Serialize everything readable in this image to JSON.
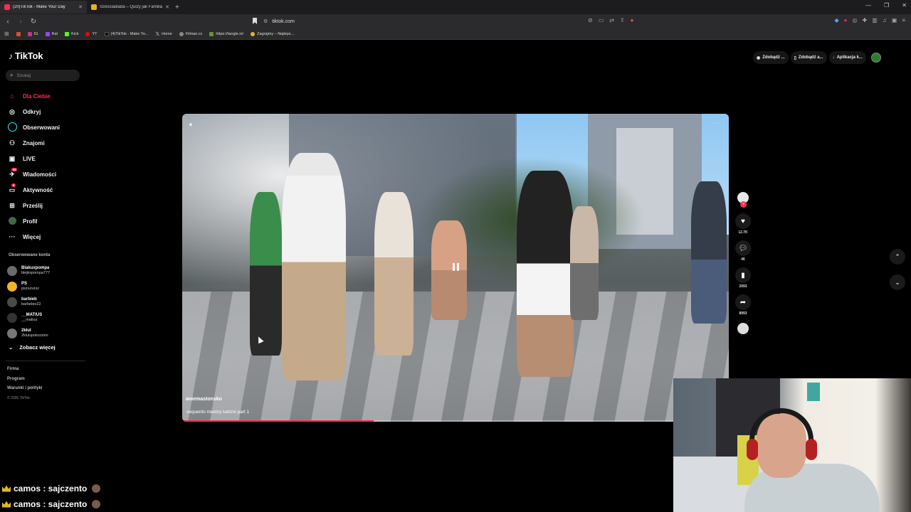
{
  "browser": {
    "tabs": [
      {
        "title": "(20)TikTok - Make Your Day",
        "active": true
      },
      {
        "title": "Sześciadiada – Quizy jak Familiada! G",
        "active": false
      }
    ],
    "url": "tiktok.com",
    "bookmarks": [
      "IG",
      "Rat",
      "Kick",
      "YT",
      "(4)TikTok - Make Yo...",
      "Home",
      "Filman.cc",
      "https://tangle.io/",
      "Zagrajmy – Najleps..."
    ]
  },
  "tiktok": {
    "logo": "TikTok",
    "search_placeholder": "Szukaj",
    "nav": [
      {
        "label": "Dla Ciebie",
        "icon": "home-icon",
        "active": true
      },
      {
        "label": "Odkryj",
        "icon": "compass-icon"
      },
      {
        "label": "Obserwowani",
        "icon": "following-icon"
      },
      {
        "label": "Znajomi",
        "icon": "friends-icon"
      },
      {
        "label": "LIVE",
        "icon": "live-icon"
      },
      {
        "label": "Wiadomości",
        "icon": "messages-icon",
        "badge": "99"
      },
      {
        "label": "Aktywność",
        "icon": "activity-icon",
        "badge": "8"
      },
      {
        "label": "Prześlij",
        "icon": "upload-icon"
      },
      {
        "label": "Profil",
        "icon": "profile-icon"
      },
      {
        "label": "Więcej",
        "icon": "more-icon"
      }
    ],
    "following_title": "Obserwowane konta",
    "following": [
      {
        "name": "Blakuxpompa",
        "handle": "blejkxpompa777"
      },
      {
        "name": "PS",
        "handle": "pszszszsz"
      },
      {
        "name": "barbieb",
        "handle": "barbebie22"
      },
      {
        "name": "__MATIUS",
        "handle": "__matius"
      },
      {
        "name": "2kłul",
        "handle": "2klulspokoziom"
      }
    ],
    "see_more": "Zobacz więcej",
    "footer": [
      "Firma",
      "Program",
      "Warunki i polityki"
    ],
    "copyright": "© 2026 TikTok",
    "top_actions": [
      "Zdobądź ...",
      "Zdobądź a...",
      "Aplikacja k..."
    ],
    "video": {
      "author": "aniemastonsko",
      "description": "sequento miedzy ludzmi part 1",
      "progress": 0.35
    },
    "actions": {
      "likes": "12.7K",
      "comments": "46",
      "saves": "2093",
      "shares": "8993"
    }
  },
  "chat": [
    {
      "text": "camos : sajczento"
    },
    {
      "text": "camos : sajczento"
    }
  ],
  "colors": {
    "accent": "#fe2c55",
    "cyan": "#25f4ee"
  }
}
